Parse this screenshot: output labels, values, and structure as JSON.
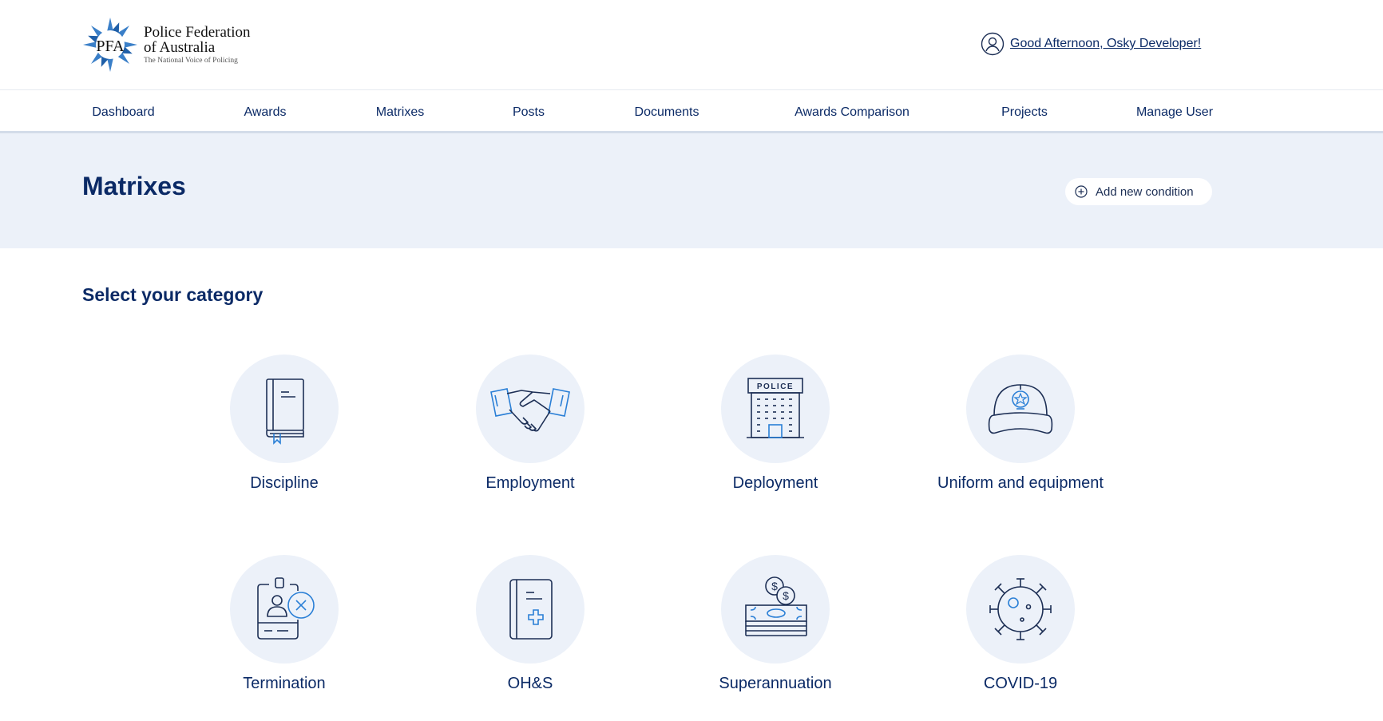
{
  "header": {
    "logo": {
      "monogram": "PFA",
      "line1": "Police Federation",
      "line2": "of Australia",
      "tagline": "The National Voice of Policing"
    },
    "greeting": "Good Afternoon, Osky Developer!",
    "greeting_icon": "user-circle-icon"
  },
  "nav": {
    "items": [
      {
        "label": "Dashboard",
        "active": false
      },
      {
        "label": "Awards",
        "active": false
      },
      {
        "label": "Matrixes",
        "active": true
      },
      {
        "label": "Posts",
        "active": false
      },
      {
        "label": "Documents",
        "active": false
      },
      {
        "label": "Awards Comparison",
        "active": false
      },
      {
        "label": "Projects",
        "active": false
      },
      {
        "label": "Manage User",
        "active": false
      }
    ]
  },
  "page": {
    "title": "Matrixes",
    "add_button": "Add new condition",
    "add_icon": "plus-circle-icon"
  },
  "categories": {
    "title": "Select your category",
    "items": [
      {
        "label": "Discipline",
        "icon": "book-icon"
      },
      {
        "label": "Employment",
        "icon": "handshake-icon"
      },
      {
        "label": "Deployment",
        "icon": "police-station-icon",
        "icon_text": "POLICE"
      },
      {
        "label": "Uniform and equipment",
        "icon": "police-cap-icon"
      },
      {
        "label": "Termination",
        "icon": "id-badge-remove-icon"
      },
      {
        "label": "OH&S",
        "icon": "medical-book-icon"
      },
      {
        "label": "Superannuation",
        "icon": "money-stack-icon"
      },
      {
        "label": "COVID-19",
        "icon": "virus-icon"
      }
    ]
  },
  "colors": {
    "primary": "#0b2a66",
    "accent": "#2a7fd6",
    "band": "#ecf1f9"
  }
}
